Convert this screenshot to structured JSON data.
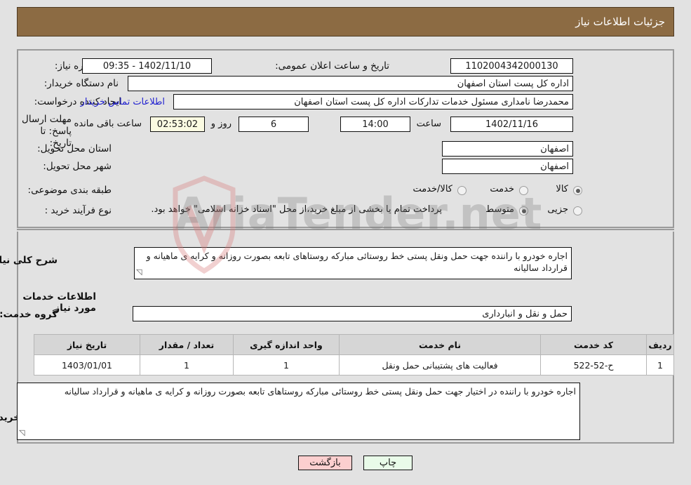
{
  "header": {
    "title": "جزئیات اطلاعات نیاز"
  },
  "watermark": {
    "text": "AriaTender.net"
  },
  "form": {
    "need_number_label": "شماره نیاز:",
    "need_number_value": "1102004342000130",
    "announce_datetime_label": "تاریخ و ساعت اعلان عمومی:",
    "announce_datetime_value": "1402/11/10 - 09:35",
    "buyer_org_label": "نام دستگاه خریدار:",
    "buyer_org_value": "اداره کل پست استان اصفهان",
    "requester_label": "ایجاد کننده درخواست:",
    "requester_value": "محمدرضا نامداری مسئول خدمات تدارکات اداره کل پست استان اصفهان",
    "buyer_contact_link": "اطلاعات تماس خریدار",
    "deadline_label": "مهلت ارسال پاسخ: تا تاریخ:",
    "deadline_date_value": "1402/11/16",
    "hour_label": "ساعت",
    "deadline_time_value": "14:00",
    "days_value": "6",
    "days_label": "روز و",
    "countdown_value": "02:53:02",
    "remaining_label": "ساعت باقی مانده",
    "delivery_province_label": "استان محل تحویل:",
    "delivery_province_value": "اصفهان",
    "delivery_city_label": "شهر محل تحویل:",
    "delivery_city_value": "اصفهان",
    "category_label": "طبقه بندی موضوعی:",
    "category_options": [
      "کالا",
      "خدمت",
      "کالا/خدمت"
    ],
    "category_selected": "خدمت",
    "purchase_type_label": "نوع فرآیند خرید :",
    "purchase_type_options": [
      "جزیی",
      "متوسط"
    ],
    "purchase_type_selected": "متوسط",
    "treasury_note": "پرداخت تمام یا بخشی از مبلغ خرید،از محل \"اسناد خزانه اسلامی\" خواهد بود."
  },
  "description": {
    "label": "شرح کلی نیاز:",
    "value": "اجاره خودرو با راننده جهت حمل ونقل پستی خط روستائی مبارکه روستاهای تابعه بصورت روزانه و کرایه ی ماهیانه و قرارداد سالیانه"
  },
  "services_section": {
    "heading": "اطلاعات خدمات مورد نیاز",
    "group_label": "گروه خدمت:",
    "group_value": "حمل و نقل و انبارداری"
  },
  "table": {
    "columns": [
      "ردیف",
      "کد خدمت",
      "نام خدمت",
      "واحد اندازه گیری",
      "تعداد / مقدار",
      "تاریخ نیاز"
    ],
    "rows": [
      {
        "row": "1",
        "service_code": "ح-52-522",
        "service_name": "فعالیت های پشتیبانی حمل ونقل",
        "unit": "1",
        "quantity": "1",
        "need_date": "1403/01/01"
      }
    ]
  },
  "buyer_notes": {
    "label": "توضیحات خریدار:",
    "value": "اجاره خودرو با راننده در اختیار جهت حمل ونقل پستی خط روستائی مبارکه روستاهای تابعه بصورت روزانه و کرایه ی ماهیانه و قرارداد سالیانه"
  },
  "footer": {
    "print_label": "چاپ",
    "back_label": "بازگشت"
  },
  "colors": {
    "header_bg": "#8c6b43",
    "page_bg": "#e2e2e2",
    "link": "#2020d0",
    "print_btn": "#e9fbe9",
    "back_btn": "#fccfcf",
    "countdown_bg": "#fbfbe2"
  }
}
